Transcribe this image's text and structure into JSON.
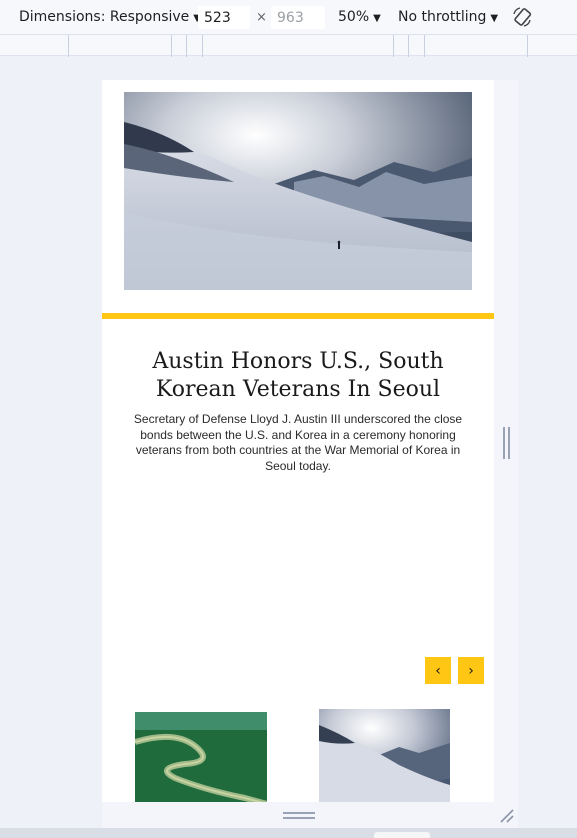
{
  "toolbar": {
    "dimensions_label": "Dimensions: Responsive",
    "width_value": "523",
    "times_sign": "×",
    "height_placeholder": "963",
    "zoom_label": "50%",
    "throttle_label": "No throttling",
    "caret_icon": "▼",
    "rotate_icon": "rotate-device-icon"
  },
  "page": {
    "hero_image": "snowy-mountain-slope-with-hiker",
    "accent_color": "#ffc713",
    "headline": "Austin Honors U.S., South Korean Veterans In Seoul",
    "summary": "Secretary of Defense Lloyd J. Austin III underscored the close bonds between the U.S. and Korea in a ceremony honoring veterans from both countries at the War Memorial of Korea in Seoul today.",
    "prev_icon": "‹",
    "next_icon": "›",
    "thumbnails": [
      "aerial-green-river",
      "snowy-mountain-slope"
    ]
  }
}
